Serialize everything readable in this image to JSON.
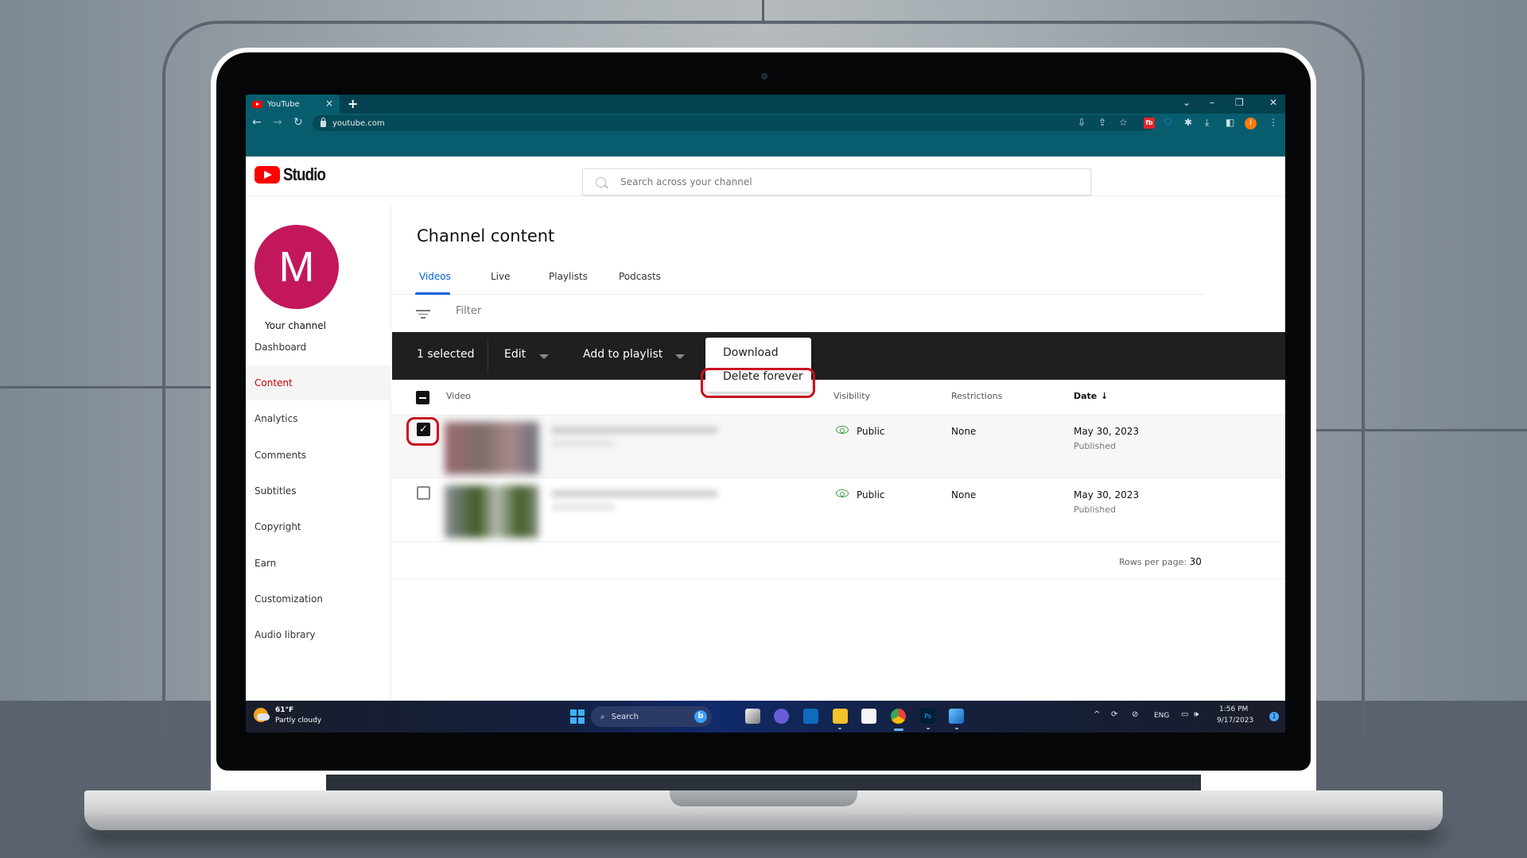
{
  "browser": {
    "tab_title": "YouTube",
    "tab_close": "×",
    "new_tab": "+",
    "url": "youtube.com",
    "window_controls": {
      "tabs_menu": "⌄",
      "minimize": "–",
      "restore": "❐",
      "close": "✕"
    },
    "nav": {
      "back": "←",
      "forward": "→",
      "reload": "↻"
    },
    "toolbar_icons": {
      "install": "⇩",
      "share": "⇪",
      "bookmark": "☆",
      "ext_badge": "fb",
      "shield": "⛉",
      "extensions": "✱",
      "downloads": "⤓",
      "side_panel": "◧",
      "profile_initial": "I",
      "menu": "⋮"
    }
  },
  "studio": {
    "logo_text": "Studio",
    "search_placeholder": "Search across your channel"
  },
  "sidebar": {
    "avatar_initial": "M",
    "avatar_color": "#c2185b",
    "channel_label": "Your channel",
    "items": [
      {
        "label": "Dashboard",
        "active": false
      },
      {
        "label": "Content",
        "active": true
      },
      {
        "label": "Analytics",
        "active": false
      },
      {
        "label": "Comments",
        "active": false
      },
      {
        "label": "Subtitles",
        "active": false
      },
      {
        "label": "Copyright",
        "active": false
      },
      {
        "label": "Earn",
        "active": false
      },
      {
        "label": "Customization",
        "active": false
      },
      {
        "label": "Audio library",
        "active": false
      }
    ]
  },
  "main": {
    "title": "Channel content",
    "tabs": [
      {
        "label": "Videos",
        "active": true
      },
      {
        "label": "Live",
        "active": false
      },
      {
        "label": "Playlists",
        "active": false
      },
      {
        "label": "Podcasts",
        "active": false
      }
    ],
    "filter_placeholder": "Filter",
    "action_bar": {
      "selected_count": "1 selected",
      "edit_label": "Edit",
      "add_to_playlist_label": "Add to playlist",
      "more_menu": [
        "Download",
        "Delete forever"
      ],
      "highlighted_item": "Delete forever"
    },
    "columns": {
      "video": "Video",
      "visibility": "Visibility",
      "restrictions": "Restrictions",
      "date": "Date",
      "date_sort_icon": "↓"
    },
    "rows": [
      {
        "selected": true,
        "title": "[blurred]",
        "visibility": "Public",
        "restrictions": "None",
        "date": "May 30, 2023",
        "status": "Published"
      },
      {
        "selected": false,
        "title": "[blurred]",
        "visibility": "Public",
        "restrictions": "None",
        "date": "May 30, 2023",
        "status": "Published"
      }
    ],
    "rows_per_page_label": "Rows per page:",
    "rows_per_page_value": "30",
    "accent_color": "#065fd4",
    "highlight_color": "#c8101f"
  },
  "taskbar": {
    "weather_temp": "61°F",
    "weather_desc": "Partly cloudy",
    "search_label": "Search",
    "bing_glyph": "b",
    "apps": [
      "Task View",
      "Teams",
      "Outlook",
      "File Explorer",
      "Microsoft Store",
      "Chrome",
      "Photoshop",
      "Photos"
    ],
    "tray": {
      "chevron": "^",
      "lang": "ENG",
      "time": "1:56 PM",
      "date": "9/17/2023",
      "notifications": "1"
    }
  }
}
